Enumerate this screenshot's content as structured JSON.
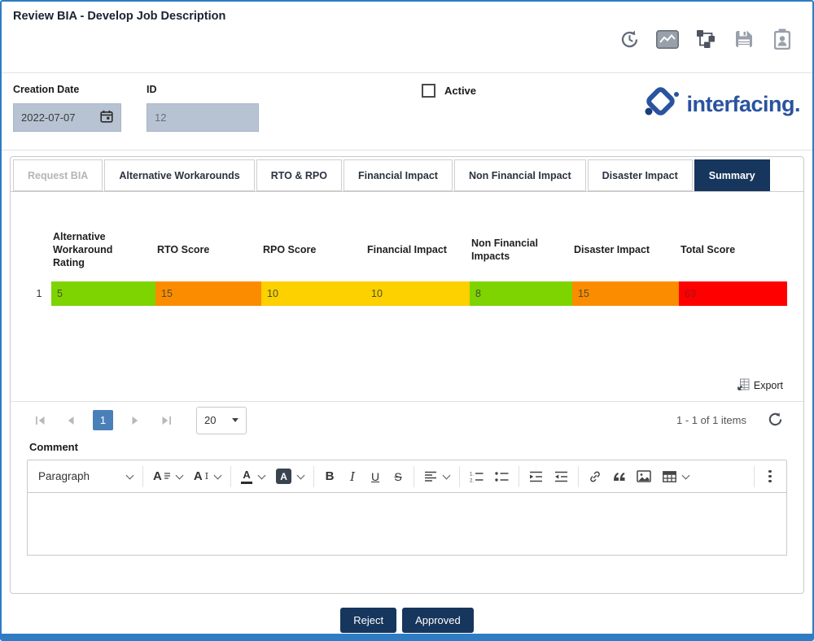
{
  "page": {
    "title": "Review BIA - Develop Job Description"
  },
  "colors": {
    "frame_blue": "#2e7cc3",
    "primary_navy": "#17365d",
    "pager_active_blue": "#4a80b9",
    "logo_blue": "#2a53a0",
    "score_green": "#7ed400",
    "score_orange": "#fb8c00",
    "score_yellow": "#fdd000",
    "score_red": "#fe0000"
  },
  "header": {
    "icons": [
      "history-icon",
      "chart-icon",
      "hierarchy-icon",
      "save-icon",
      "assignee-icon"
    ]
  },
  "logo": {
    "text": "interfacing."
  },
  "form": {
    "creation_date": {
      "label": "Creation Date",
      "value": "2022-07-07"
    },
    "id_field": {
      "label": "ID",
      "value": "12"
    },
    "active": {
      "label": "Active",
      "checked": false
    }
  },
  "tabs": [
    {
      "label": "Request BIA",
      "state": "disabled"
    },
    {
      "label": "Alternative Workarounds",
      "state": "normal"
    },
    {
      "label": "RTO & RPO",
      "state": "normal"
    },
    {
      "label": "Financial Impact",
      "state": "normal"
    },
    {
      "label": "Non Financial Impact",
      "state": "normal"
    },
    {
      "label": "Disaster Impact",
      "state": "normal"
    },
    {
      "label": "Summary",
      "state": "active"
    }
  ],
  "table": {
    "columns": [
      "Alternative Workaround Rating",
      "RTO Score",
      "RPO Score",
      "Financial Impact",
      "Non Financial Impacts",
      "Disaster Impact",
      "Total Score"
    ],
    "rows": [
      {
        "index": "1",
        "cells": [
          {
            "value": "5",
            "color": "#7ed400"
          },
          {
            "value": "15",
            "color": "#fb8c00"
          },
          {
            "value": "10",
            "color": "#fdd000"
          },
          {
            "value": "10",
            "color": "#fdd000"
          },
          {
            "value": "8",
            "color": "#7ed400"
          },
          {
            "value": "15",
            "color": "#fb8c00"
          },
          {
            "value": "63",
            "color": "#fe0000"
          }
        ]
      }
    ]
  },
  "export": {
    "label": "Export"
  },
  "pagination": {
    "current_page": "1",
    "page_size": "20",
    "range_text": "1 - 1 of 1 items"
  },
  "comment": {
    "label": "Comment"
  },
  "editor": {
    "paragraph_label": "Paragraph"
  },
  "actions": {
    "reject_label": "Reject",
    "approve_label": "Approved"
  }
}
